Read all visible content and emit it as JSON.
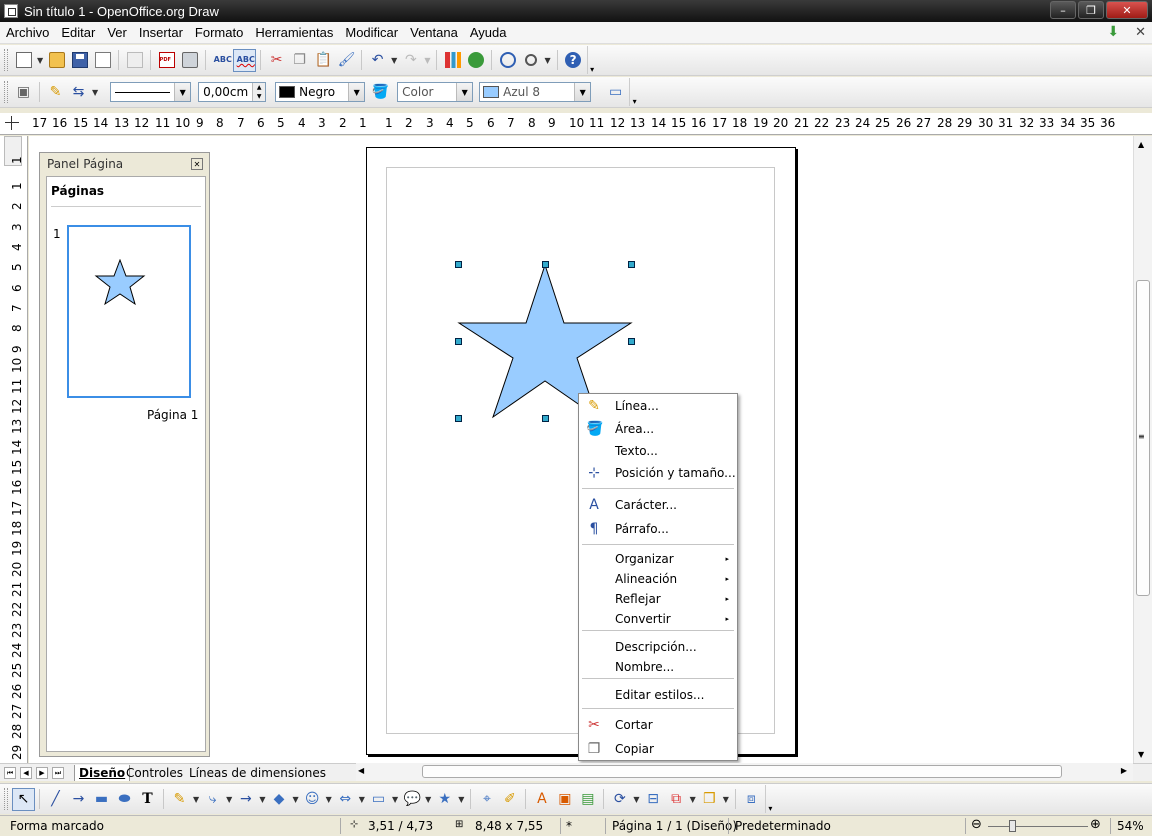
{
  "window": {
    "title": "Sin título 1 - OpenOffice.org Draw",
    "minimize": "–",
    "maximize": "❐",
    "close": "✕"
  },
  "menu": {
    "items": [
      "Archivo",
      "Editar",
      "Ver",
      "Insertar",
      "Formato",
      "Herramientas",
      "Modificar",
      "Ventana",
      "Ayuda"
    ],
    "close_doc": "✕"
  },
  "line_toolbar": {
    "line_width": "0,00cm",
    "line_color": "Negro",
    "line_color_hex": "#000000",
    "area_style": "Color",
    "area_color": "Azul 8",
    "area_color_hex": "#99ccff"
  },
  "rulers": {
    "horizontal": [
      "17",
      "16",
      "15",
      "14",
      "13",
      "12",
      "11",
      "10",
      "9",
      "8",
      "7",
      "6",
      "5",
      "4",
      "3",
      "2",
      "1",
      "1",
      "2",
      "3",
      "4",
      "5",
      "6",
      "7",
      "8",
      "9",
      "10",
      "11",
      "12",
      "13",
      "14",
      "15",
      "16",
      "17",
      "18",
      "19",
      "20",
      "21",
      "22",
      "23",
      "24",
      "25",
      "26",
      "27",
      "28",
      "29",
      "30",
      "31",
      "32",
      "33",
      "34",
      "35",
      "36"
    ],
    "vertical": [
      "1",
      "1",
      "2",
      "3",
      "4",
      "5",
      "6",
      "7",
      "8",
      "9",
      "10",
      "11",
      "12",
      "13",
      "14",
      "15",
      "16",
      "17",
      "18",
      "19",
      "20",
      "21",
      "22",
      "23",
      "24",
      "25",
      "26",
      "27",
      "28",
      "29"
    ]
  },
  "page_panel": {
    "title": "Panel Página",
    "header": "Páginas",
    "page_number": "1",
    "page_name": "Página 1"
  },
  "shape": {
    "fill_hex": "#99ccff",
    "stroke_hex": "#000000"
  },
  "context_menu": {
    "items": [
      {
        "label": "Línea...",
        "icon": "line-pen-icon"
      },
      {
        "label": "Área...",
        "icon": "area-bucket-icon"
      },
      {
        "label": "Texto...",
        "icon": ""
      },
      {
        "label": "Posición y tamaño...",
        "icon": "position-size-icon"
      },
      {
        "label": "Carácter...",
        "icon": "character-icon"
      },
      {
        "label": "Párrafo...",
        "icon": "paragraph-icon"
      },
      {
        "label": "Organizar",
        "icon": ""
      },
      {
        "label": "Alineación",
        "icon": ""
      },
      {
        "label": "Reflejar",
        "icon": ""
      },
      {
        "label": "Convertir",
        "icon": ""
      },
      {
        "label": "Descripción...",
        "icon": ""
      },
      {
        "label": "Nombre...",
        "icon": ""
      },
      {
        "label": "Editar estilos...",
        "icon": ""
      },
      {
        "label": "Cortar",
        "icon": "scissors-icon"
      },
      {
        "label": "Copiar",
        "icon": "copy-icon"
      }
    ],
    "submenu_arrow": "▸"
  },
  "tabs": {
    "items": [
      "Diseño",
      "Controles",
      "Líneas de dimensiones"
    ],
    "active": "Diseño"
  },
  "statusbar": {
    "mode": "Forma marcado",
    "position": "3,51 / 4,73",
    "size": "8,48 x 7,55",
    "modified": "*",
    "page": "Página 1 / 1 (Diseño)",
    "style": "Predeterminado",
    "zoom_minus": "⊖",
    "zoom_plus": "⊕",
    "zoom": "54%"
  }
}
